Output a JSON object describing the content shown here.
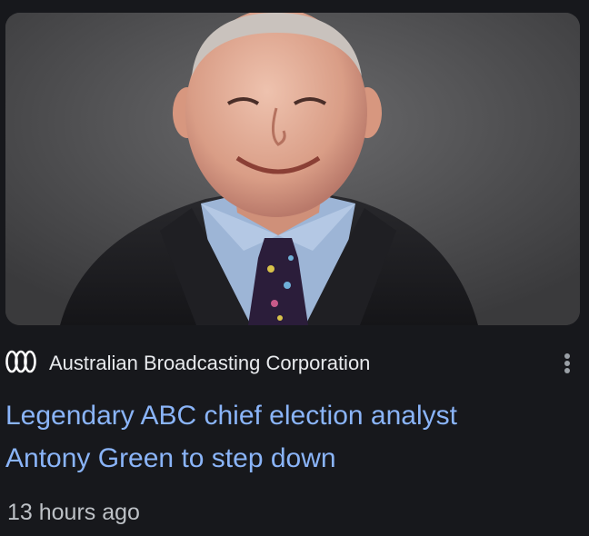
{
  "article": {
    "image_icon": "portrait-photo",
    "source": {
      "logo_icon": "abc-lissajous-logo-icon",
      "name": "Australian Broadcasting Corporation"
    },
    "more_icon": "more-vertical-icon",
    "headline_line1": "Legendary ABC chief election analyst",
    "headline_line2": "Antony Green to step down",
    "time": "13 hours ago"
  },
  "colors": {
    "background": "#17181c",
    "headline": "#8ab4f8",
    "source_text": "#e8eaed",
    "time_text": "#bdc1c6"
  }
}
